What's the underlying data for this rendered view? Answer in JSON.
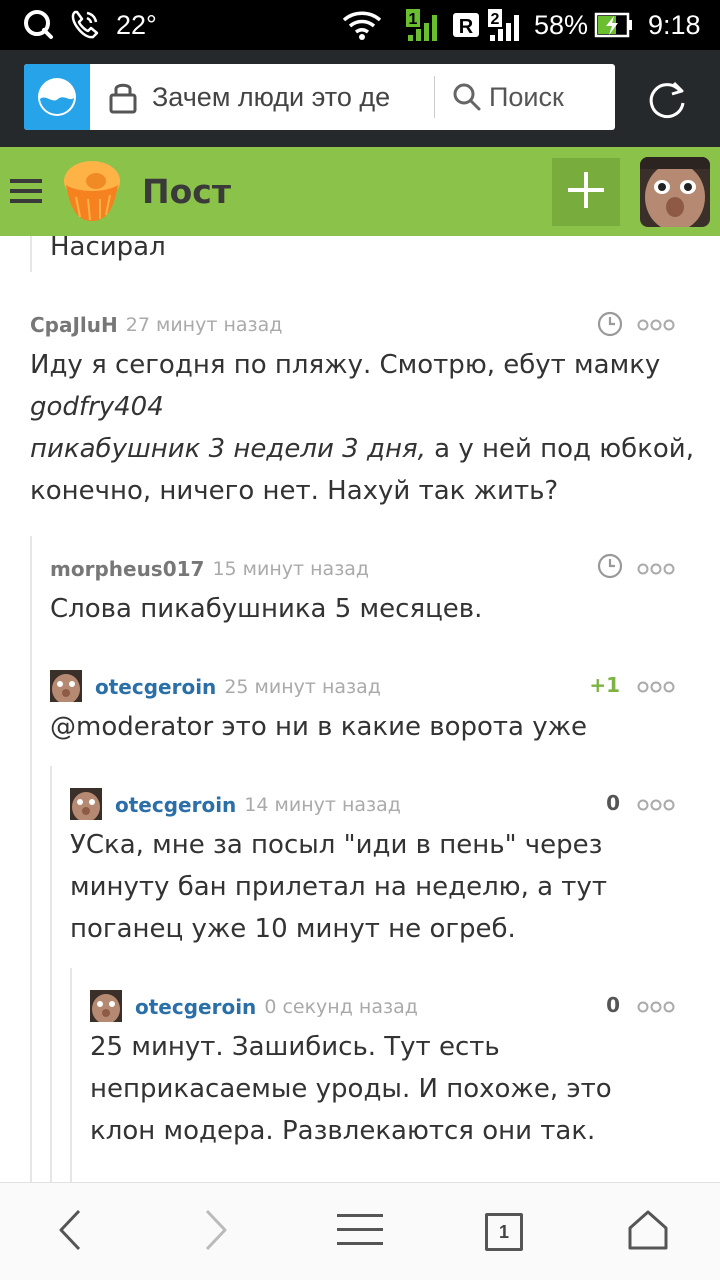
{
  "status_bar": {
    "temperature": "22°",
    "battery": "58%",
    "time": "9:18",
    "icons": [
      "qq-icon",
      "missed-call-icon",
      "wifi-icon",
      "signal-1-icon",
      "roaming-r-icon",
      "signal-2-icon",
      "battery-charging-icon"
    ],
    "sim1_label": "1",
    "sim2_label": "2",
    "roaming_label": "R"
  },
  "browser": {
    "url": "Зачем люди это де",
    "search_placeholder": "Поиск",
    "icons": [
      "browser-logo-icon",
      "lock-icon",
      "search-icon",
      "reload-icon"
    ]
  },
  "header": {
    "title": "Пост",
    "icons": [
      "menu-icon",
      "cupcake-logo-icon",
      "plus-icon",
      "avatar"
    ],
    "colors": {
      "background": "#8bc34a",
      "add_button": "#78ad3e"
    }
  },
  "comments": {
    "prev_tail": "Насирал",
    "c1": {
      "author": "CpaJluH",
      "time": "27 минут назад",
      "line1": "Иду я сегодня по пляжу. Смотрю, ебут мамку",
      "mention_user": "godfry404",
      "mention_info": "пикабушник 3 недели 3 дня,",
      "line3_rest": " а у ней под юбкой,",
      "line4": "конечно, ничего нет.  Нахуй так жить?"
    },
    "c2": {
      "author": "morpheus017",
      "time": "15 минут назад",
      "line1": "Слова пикабушника 5 месяцев."
    },
    "c3": {
      "author": "otecgeroin",
      "time": "25 минут назад",
      "rating": "+1",
      "line1": "@moderator это ни в какие ворота уже"
    },
    "c4": {
      "author": "otecgeroin",
      "time": "14 минут назад",
      "rating": "0",
      "line1": "УСка, мне за посыл \"иди в пень\" через",
      "line2": "минуту бан прилетал на неделю, а тут",
      "line3": "поганец уже 10 минут не огреб."
    },
    "c5": {
      "author": "otecgeroin",
      "time": "0 секунд назад",
      "rating": "0",
      "line1": "25 минут. Зашибись. Тут есть",
      "line2": "неприкасаемые уроды. И похоже, это",
      "line3": "клон модера. Развлекаются они так."
    }
  },
  "bottom_nav": {
    "tabs_count": "1",
    "icons": [
      "back-icon",
      "forward-icon",
      "menu-icon",
      "tabs-icon",
      "home-icon"
    ]
  }
}
